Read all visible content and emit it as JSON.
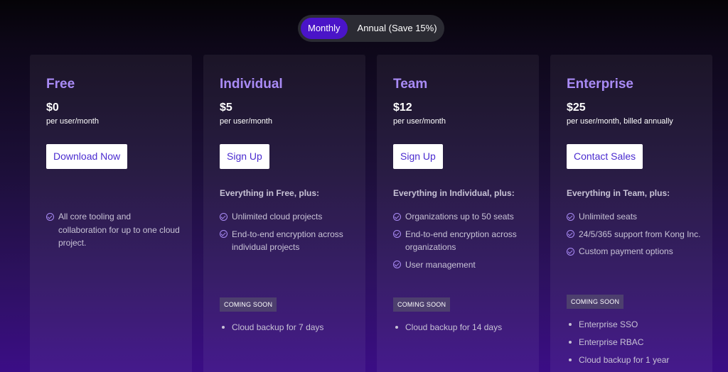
{
  "billing_toggle": {
    "monthly_label": "Monthly",
    "annual_label": "Annual (Save 15%)",
    "selected": "Monthly"
  },
  "plans": [
    {
      "name": "Free",
      "price": "$0",
      "price_sub": "per user/month",
      "cta": "Download Now",
      "plus_label": "",
      "features": [
        "All core tooling and collaboration for up to one cloud project."
      ],
      "coming_soon_label": "",
      "coming_soon": []
    },
    {
      "name": "Individual",
      "price": "$5",
      "price_sub": "per user/month",
      "cta": "Sign Up",
      "plus_label": "Everything in Free, plus:",
      "features": [
        "Unlimited cloud projects",
        "End-to-end encryption across individual projects"
      ],
      "coming_soon_label": "COMING SOON",
      "coming_soon": [
        "Cloud backup for 7 days"
      ]
    },
    {
      "name": "Team",
      "price": "$12",
      "price_sub": "per user/month",
      "cta": "Sign Up",
      "plus_label": "Everything in Individual, plus:",
      "features": [
        "Organizations up to 50 seats",
        "End-to-end encryption across organizations",
        "User management"
      ],
      "coming_soon_label": "COMING SOON",
      "coming_soon": [
        "Cloud backup for 14 days"
      ]
    },
    {
      "name": "Enterprise",
      "price": "$25",
      "price_sub": "per user/month, billed annually",
      "cta": "Contact Sales",
      "plus_label": "Everything in Team, plus:",
      "features": [
        "Unlimited seats",
        "24/5/365 support from Kong Inc.",
        "Custom payment options"
      ],
      "coming_soon_label": "COMING SOON",
      "coming_soon": [
        "Enterprise SSO",
        "Enterprise RBAC",
        "Cloud backup for 1 year"
      ]
    }
  ],
  "colors": {
    "accent": "#a98bf6",
    "toggle_active": "#4a14c8",
    "cta_text": "#4a2bd0"
  }
}
